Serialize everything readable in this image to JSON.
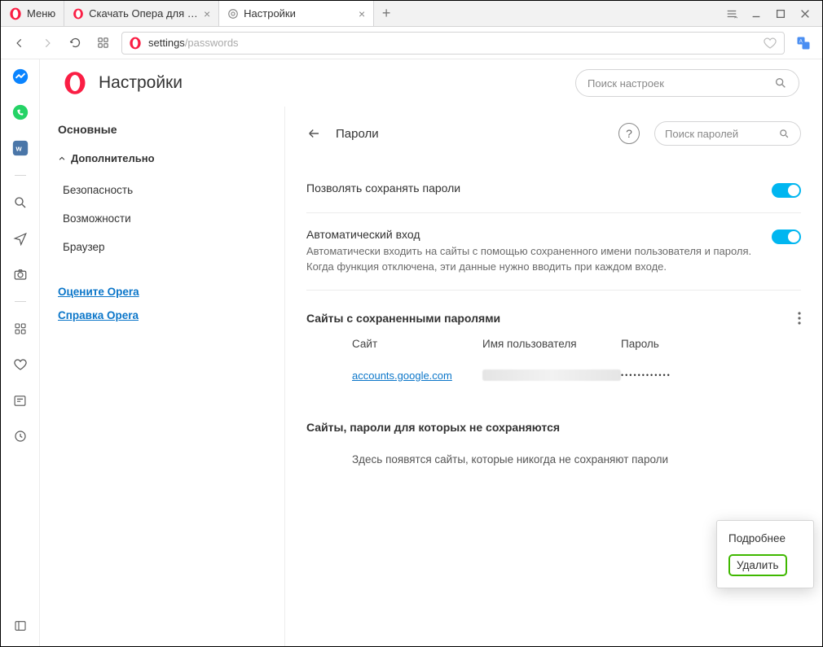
{
  "window": {
    "menu_label": "Меню",
    "tabs": [
      {
        "favicon": "opera-red",
        "label": "Скачать Опера для компь..."
      },
      {
        "favicon": "gear",
        "label": "Настройки"
      }
    ]
  },
  "addressbar": {
    "prefix": "settings",
    "suffix": "/passwords"
  },
  "settings": {
    "title": "Настройки",
    "search_placeholder": "Поиск настроек"
  },
  "sidebar": {
    "items": [
      "Основные",
      "Дополнительно",
      "Безопасность",
      "Возможности",
      "Браузер"
    ],
    "links": [
      "Оцените Opera",
      "Справка Opera"
    ]
  },
  "page": {
    "title": "Пароли",
    "search_placeholder": "Поиск паролей",
    "save_passwords_label": "Позволять сохранять пароли",
    "autologin_title": "Автоматический вход",
    "autologin_desc": "Автоматически входить на сайты с помощью сохраненного имени пользователя и пароля. Когда функция отключена, эти данные нужно вводить при каждом входе.",
    "saved_section": "Сайты с сохраненными паролями",
    "columns": {
      "site": "Сайт",
      "user": "Имя пользователя",
      "password": "Пароль"
    },
    "rows": [
      {
        "site": "accounts.google.com",
        "password_mask": "••••••••••••"
      }
    ],
    "never_section": "Сайты, пароли для которых не сохраняются",
    "never_empty": "Здесь появятся сайты, которые никогда не сохраняют пароли"
  },
  "popup": {
    "more": "Подробнее",
    "delete": "Удалить"
  }
}
